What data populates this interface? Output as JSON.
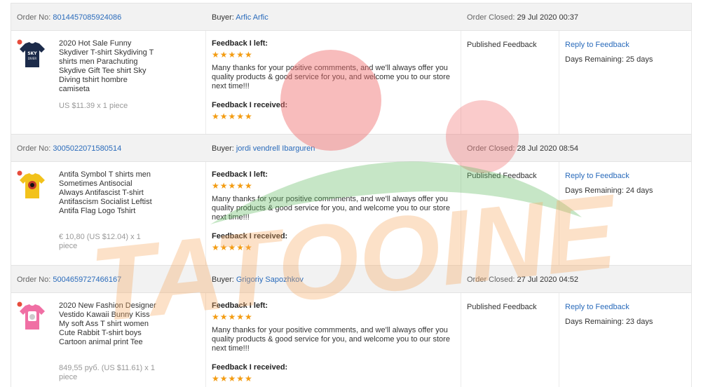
{
  "labels": {
    "order_no": "Order No:",
    "buyer": "Buyer:",
    "order_closed": "Order Closed:",
    "feedback_left": "Feedback I left:",
    "feedback_received": "Feedback I received:",
    "published": "Published Feedback",
    "reply": "Reply to Feedback",
    "stars": "★★★★★"
  },
  "watermark": {
    "text": "TATOOINE",
    "colors": {
      "circle": "#f06a6a",
      "leaf": "#5cb85c",
      "letters": "#f5a860"
    }
  },
  "orders": [
    {
      "order_no": "8014457085924086",
      "buyer": "Arfic Arfic",
      "closed": "29 Jul 2020 00:37",
      "product": "2020 Hot Sale Funny Skydiver T-shirt Skydiving T shirts men Parachuting Skydive Gift Tee shirt Sky Diving tshirt hombre camiseta",
      "price": "US $11.39 x 1 piece",
      "thumb_icon": "navy-tshirt-icon",
      "feedback_text": "Many thanks for your positive commments, and we'll always offer you quality products & good service for you, and welcome you to our store next time!!!",
      "days_remaining": "Days Remaining: 25 days"
    },
    {
      "order_no": "3005022071580514",
      "buyer": "jordi vendrell Ibarguren",
      "closed": "28 Jul 2020 08:54",
      "product": "Antifa Symbol T shirts men Sometimes Antisocial Always Antifascist T-shirt Antifascism Socialist Leftist Antifa Flag Logo Tshirt",
      "price": "€ 10,80 (US $12.04) x 1 piece",
      "thumb_icon": "yellow-tshirt-icon",
      "feedback_text": "Many thanks for your positive commments, and we'll always offer you quality products & good service for you, and welcome you to our store next time!!!",
      "days_remaining": "Days Remaining: 24 days"
    },
    {
      "order_no": "5004659727466167",
      "buyer": "Grigoriy Sapozhkov",
      "closed": "27 Jul 2020 04:52",
      "product": "2020 New Fashion Designer Vestido Kawaii Bunny Kiss My soft Ass T shirt women Cute Rabbit T-shirt boys Cartoon animal print Tee",
      "price": "849,55 руб. (US $11.61) x 1 piece",
      "thumb_icon": "pink-tshirt-icon",
      "feedback_text": "Many thanks for your positive commments, and we'll always offer you quality products & good service for you, and welcome you to our store next time!!!",
      "days_remaining": "Days Remaining: 23 days"
    }
  ]
}
